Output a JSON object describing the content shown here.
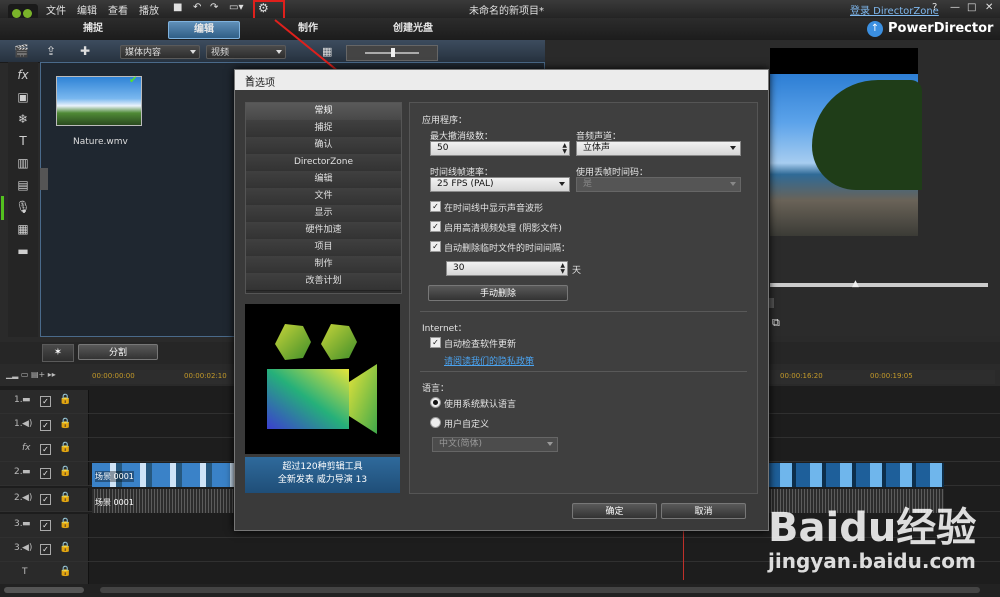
{
  "window": {
    "title": "未命名的新项目*",
    "login": "登录 DirectorZone",
    "help": "?",
    "brand": "PowerDirector",
    "controls": [
      "—",
      "□",
      "✕"
    ]
  },
  "menu": [
    "文件",
    "编辑",
    "查看",
    "播放"
  ],
  "tabs": [
    {
      "label": "捕捉",
      "active": false
    },
    {
      "label": "编辑",
      "active": true
    },
    {
      "label": "制作",
      "active": false
    },
    {
      "label": "创建光盘",
      "active": false
    }
  ],
  "library": {
    "filter_combo": "媒体内容",
    "type_combo": "视频",
    "clip_name": "Nature.wmv"
  },
  "timeline": {
    "split_label": "分割",
    "times": [
      "00:00:00:00",
      "00:00:02:10",
      "00:00:16:20",
      "00:00:19:05"
    ],
    "track_labels": [
      "1.",
      "1.",
      "fx",
      "2.",
      "2.",
      "3.",
      "3.",
      "T"
    ],
    "clip_labels": [
      "场景 0001",
      "场景 0001"
    ]
  },
  "dialog": {
    "title": "首选项",
    "close": "✕",
    "nav": [
      "常规",
      "捕捉",
      "确认",
      "DirectorZone",
      "编辑",
      "文件",
      "显示",
      "硬件加速",
      "项目",
      "制作",
      "改善计划"
    ],
    "selected_nav": 0,
    "promo_line1": "超过120种剪辑工具",
    "promo_line2": "全新发表  威力导演  13",
    "sections": {
      "app": {
        "heading": "应用程序：",
        "max_undo_label": "最大撤消级数：",
        "max_undo_value": "50",
        "audio_channel_label": "音频声道：",
        "audio_channel_value": "立体声",
        "frame_rate_label": "时间线帧速率：",
        "frame_rate_value": "25 FPS (PAL)",
        "dropframe_label": "使用丢帧时间码：",
        "dropframe_value": "是",
        "cb_waveform": "在时间线中显示声音波形",
        "cb_hd": "启用高清视频处理 (阴影文件)",
        "cb_autodelete": "自动删除临时文件的时间间隔：",
        "days_value": "30",
        "days_unit": "天",
        "manual_delete": "手动删除"
      },
      "internet": {
        "heading": "Internet：",
        "cb_update": "自动检查软件更新",
        "privacy_link": "请阅读我们的隐私政策"
      },
      "language": {
        "heading": "语言：",
        "radio_system": "使用系统默认语言",
        "radio_custom": "用户自定义",
        "lang_value": "中文(简体)"
      }
    },
    "ok": "确定",
    "cancel": "取消"
  },
  "watermark": {
    "brand": "Baidu经验",
    "url": "jingyan.baidu.com"
  }
}
